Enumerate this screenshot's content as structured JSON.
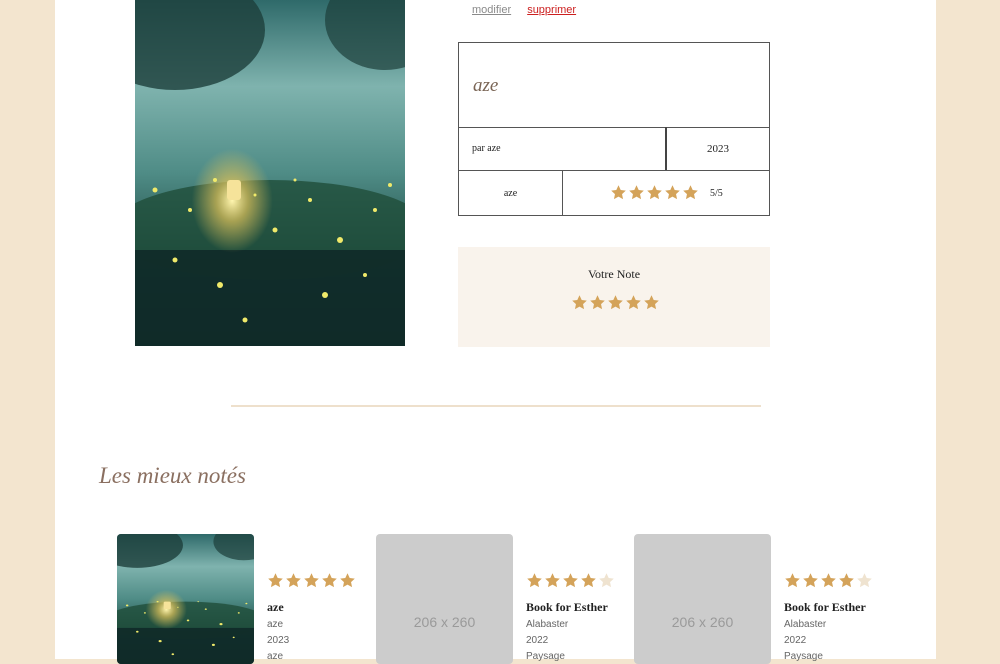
{
  "book": {
    "actions": {
      "edit": "modifier",
      "delete": "supprimer"
    },
    "title": "aze",
    "author": "par aze",
    "year": "2023",
    "genre": "aze",
    "rating": 5,
    "rating_text": "5/5"
  },
  "vote": {
    "label": "Votre Note",
    "stars": 5
  },
  "top_rated": {
    "title": "Les mieux notés",
    "cards": [
      {
        "stars": 5,
        "title": "aze",
        "author": "aze",
        "year": "2023",
        "genre": "aze",
        "image": "cover",
        "placeholder": ""
      },
      {
        "stars": 4,
        "title": "Book for Esther",
        "author": "Alabaster",
        "year": "2022",
        "genre": "Paysage",
        "image": "placeholder",
        "placeholder": "206 x 260"
      },
      {
        "stars": 4,
        "title": "Book for Esther",
        "author": "Alabaster",
        "year": "2022",
        "genre": "Paysage",
        "image": "placeholder",
        "placeholder": "206 x 260"
      }
    ]
  },
  "colors": {
    "star_on": "#d4a35a",
    "star_off": "#efe3d0",
    "background": "#f3e5cf"
  },
  "icons": {
    "star": "star-icon"
  }
}
